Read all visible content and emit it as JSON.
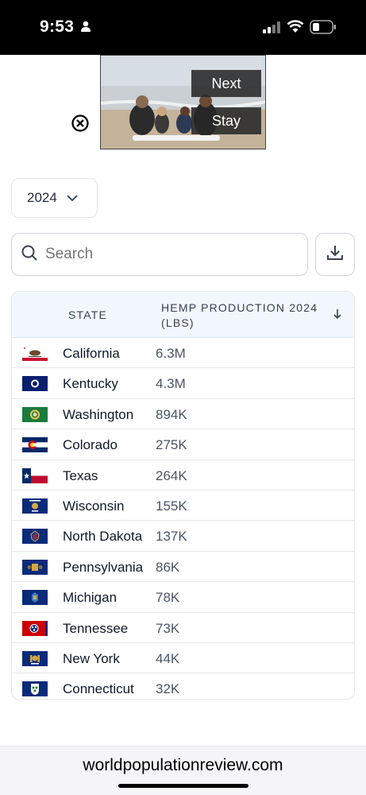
{
  "status_bar": {
    "time": "9:53"
  },
  "ad": {
    "next_label": "Next",
    "stay_label": "Stay"
  },
  "filters": {
    "year": "2024",
    "search_placeholder": "Search"
  },
  "table": {
    "headers": {
      "state": "STATE",
      "production": "HEMP PRODUCTION 2024 (LBS)"
    },
    "rows": [
      {
        "state": "California",
        "value": "6.3M",
        "flag": "california-flag"
      },
      {
        "state": "Kentucky",
        "value": "4.3M",
        "flag": "kentucky-flag"
      },
      {
        "state": "Washington",
        "value": "894K",
        "flag": "washington-flag"
      },
      {
        "state": "Colorado",
        "value": "275K",
        "flag": "colorado-flag"
      },
      {
        "state": "Texas",
        "value": "264K",
        "flag": "texas-flag"
      },
      {
        "state": "Wisconsin",
        "value": "155K",
        "flag": "wisconsin-flag"
      },
      {
        "state": "North Dakota",
        "value": "137K",
        "flag": "north-dakota-flag"
      },
      {
        "state": "Pennsylvania",
        "value": "86K",
        "flag": "pennsylvania-flag"
      },
      {
        "state": "Michigan",
        "value": "78K",
        "flag": "michigan-flag"
      },
      {
        "state": "Tennessee",
        "value": "73K",
        "flag": "tennessee-flag"
      },
      {
        "state": "New York",
        "value": "44K",
        "flag": "new-york-flag"
      },
      {
        "state": "Connecticut",
        "value": "32K",
        "flag": "connecticut-flag"
      }
    ]
  },
  "footer": {
    "url": "worldpopulationreview.com"
  }
}
